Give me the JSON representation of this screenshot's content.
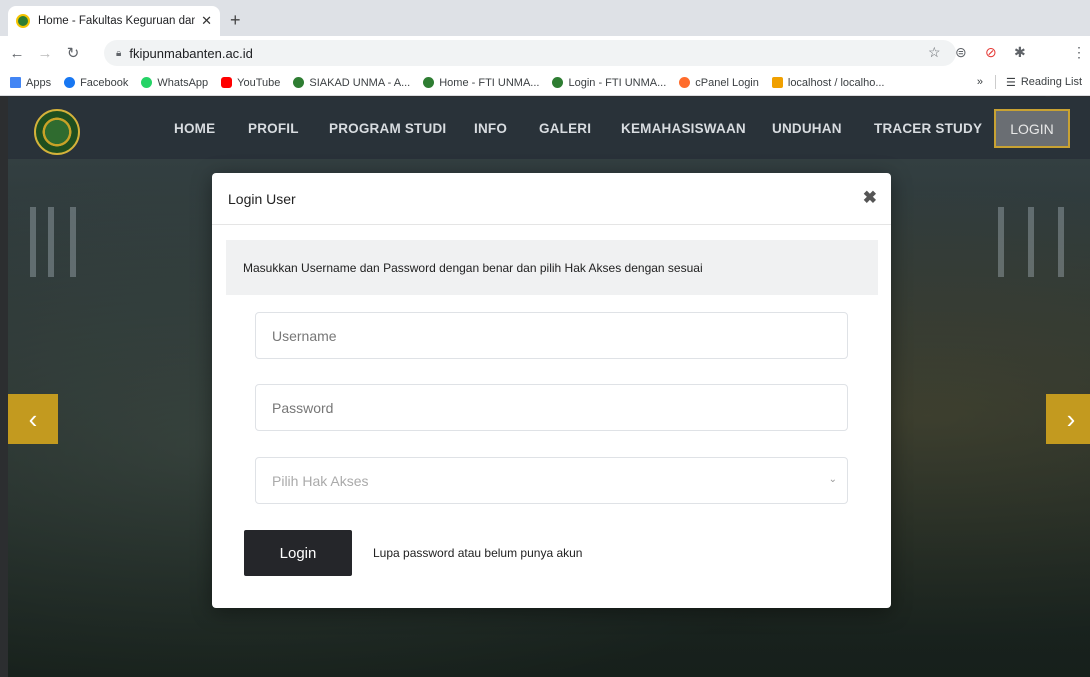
{
  "browser": {
    "tab_title": "Home - Fakultas Keguruan dan",
    "tab_close": "✕",
    "new_tab": "+",
    "url": "fkipunmabanten.ac.id",
    "bookmarks": [
      {
        "label": "Apps",
        "color": "#4285f4"
      },
      {
        "label": "Facebook",
        "color": "#1877f2"
      },
      {
        "label": "WhatsApp",
        "color": "#25d366"
      },
      {
        "label": "YouTube",
        "color": "#ff0000"
      },
      {
        "label": "SIAKAD UNMA - A...",
        "color": "#2e7d32"
      },
      {
        "label": "Home - FTI UNMA...",
        "color": "#2e7d32"
      },
      {
        "label": "Login - FTI UNMA...",
        "color": "#2e7d32"
      },
      {
        "label": "cPanel Login",
        "color": "#ff6c2c"
      },
      {
        "label": "localhost / localho...",
        "color": "#f0a000"
      }
    ],
    "more_bookmarks": "»",
    "reading_list": "Reading List"
  },
  "site": {
    "nav": {
      "items": [
        "HOME",
        "PROFIL",
        "PROGRAM STUDI",
        "INFO",
        "GALERI",
        "KEMAHASISWAAN",
        "UNDUHAN",
        "TRACER STUDY"
      ],
      "login": "LOGIN"
    },
    "carousel": {
      "prev": "‹",
      "next": "›"
    }
  },
  "modal": {
    "title": "Login User",
    "close": "✖",
    "info": "Masukkan Username dan Password dengan benar dan pilih Hak Akses dengan sesuai",
    "username_placeholder": "Username",
    "password_placeholder": "Password",
    "role_placeholder": "Pilih Hak Akses",
    "login_button": "Login",
    "forgot_link": "Lupa password atau belum punya akun"
  },
  "colors": {
    "accent": "#c8a233",
    "dark_button": "#25262a"
  }
}
